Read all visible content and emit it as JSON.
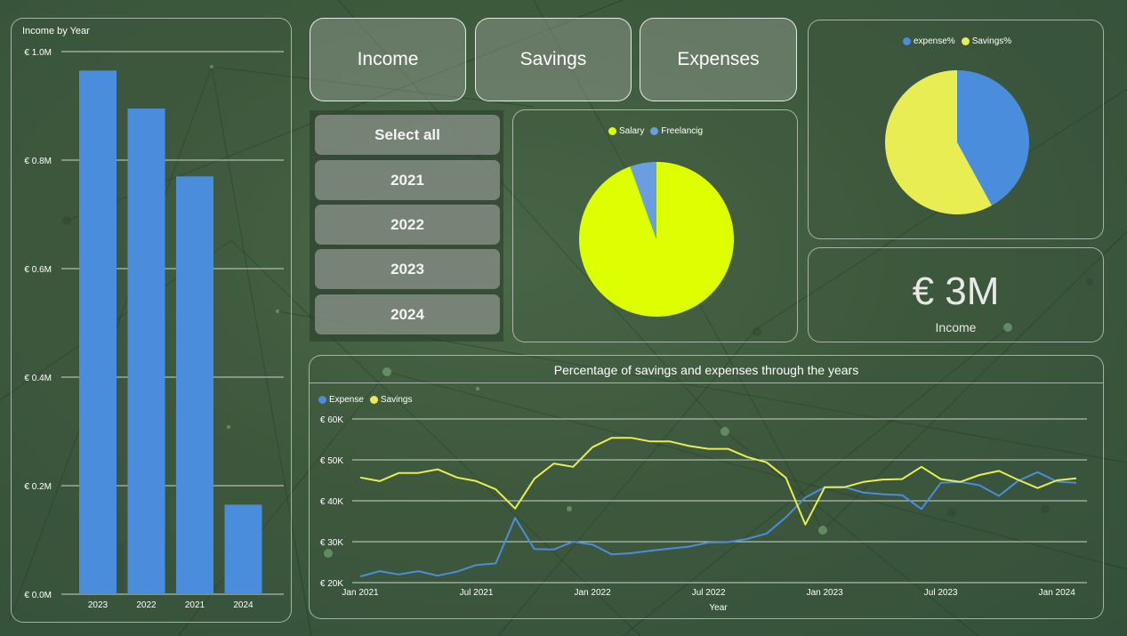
{
  "nav": {
    "income": "Income",
    "savings": "Savings",
    "expenses": "Expenses"
  },
  "slicer": {
    "items": [
      "Select all",
      "2021",
      "2022",
      "2023",
      "2024"
    ]
  },
  "colors": {
    "blue": "#4a8ddc",
    "yellow": "#e8ee52",
    "lime": "#ddff00",
    "grid": "#e6ece6"
  },
  "kpi": {
    "value": "€ 3M",
    "label": "Income"
  },
  "line_title": "Percentage of savings and expenses through the years",
  "chart_data": [
    {
      "type": "bar",
      "title": "Income by Year",
      "categories": [
        "2023",
        "2022",
        "2021",
        "2024"
      ],
      "values": [
        0.965,
        0.895,
        0.77,
        0.165
      ],
      "unit": "M",
      "ylim": [
        0,
        1.0
      ],
      "yticks": [
        "€ 0.0M",
        "€ 0.2M",
        "€ 0.4M",
        "€ 0.6M",
        "€ 0.8M",
        "€ 1.0M"
      ],
      "grid": true
    },
    {
      "type": "pie",
      "labels": [
        "Salary",
        "Freelancig"
      ],
      "values": [
        94.5,
        5.5
      ],
      "colors": [
        "#ddff00",
        "#6a9ee0"
      ],
      "legend": "top"
    },
    {
      "type": "pie",
      "labels": [
        "expense%",
        "Savings%"
      ],
      "values": [
        42,
        58
      ],
      "colors": [
        "#4a8ddc",
        "#e8ee52"
      ],
      "legend": "top"
    },
    {
      "type": "line",
      "xlabel": "Year",
      "xticks": [
        "Jan 2021",
        "Jul 2021",
        "Jan 2022",
        "Jul 2022",
        "Jan 2023",
        "Jul 2023",
        "Jan 2024"
      ],
      "yticks": [
        "€ 20K",
        "€ 30K",
        "€ 40K",
        "€ 50K",
        "€ 60K"
      ],
      "ylim": [
        20000,
        60000
      ],
      "x": [
        "2021-01",
        "2021-02",
        "2021-03",
        "2021-04",
        "2021-05",
        "2021-06",
        "2021-07",
        "2021-08",
        "2021-09",
        "2021-10",
        "2021-11",
        "2021-12",
        "2022-01",
        "2022-02",
        "2022-03",
        "2022-04",
        "2022-05",
        "2022-06",
        "2022-07",
        "2022-08",
        "2022-09",
        "2022-10",
        "2022-11",
        "2022-12",
        "2023-01",
        "2023-02",
        "2023-03",
        "2023-04",
        "2023-05",
        "2023-06",
        "2023-07",
        "2023-08",
        "2023-09",
        "2023-10",
        "2023-11",
        "2023-12",
        "2024-01",
        "2024-02"
      ],
      "series": [
        {
          "name": "Expense",
          "color": "#4a8ddc",
          "values": [
            21500,
            22800,
            22000,
            22800,
            21700,
            22700,
            24300,
            24700,
            35800,
            28200,
            28100,
            30000,
            29300,
            26900,
            27200,
            27800,
            28300,
            28800,
            29800,
            29900,
            30700,
            32000,
            36000,
            40800,
            43300,
            43400,
            42000,
            41600,
            41400,
            38000,
            44400,
            44600,
            43800,
            41200,
            44900,
            47000,
            44700,
            44400
          ]
        },
        {
          "name": "Savings",
          "color": "#e8ee52",
          "values": [
            45700,
            44800,
            46800,
            46800,
            47700,
            45700,
            44800,
            42800,
            38100,
            45400,
            49100,
            48300,
            53100,
            55400,
            55400,
            54500,
            54500,
            53400,
            52700,
            52700,
            50700,
            49400,
            45600,
            34200,
            43300,
            43300,
            44600,
            45200,
            45300,
            48300,
            45300,
            44600,
            46300,
            47300,
            45100,
            43100,
            45000,
            45500
          ]
        }
      ],
      "legend": "top-left",
      "grid": true
    }
  ]
}
